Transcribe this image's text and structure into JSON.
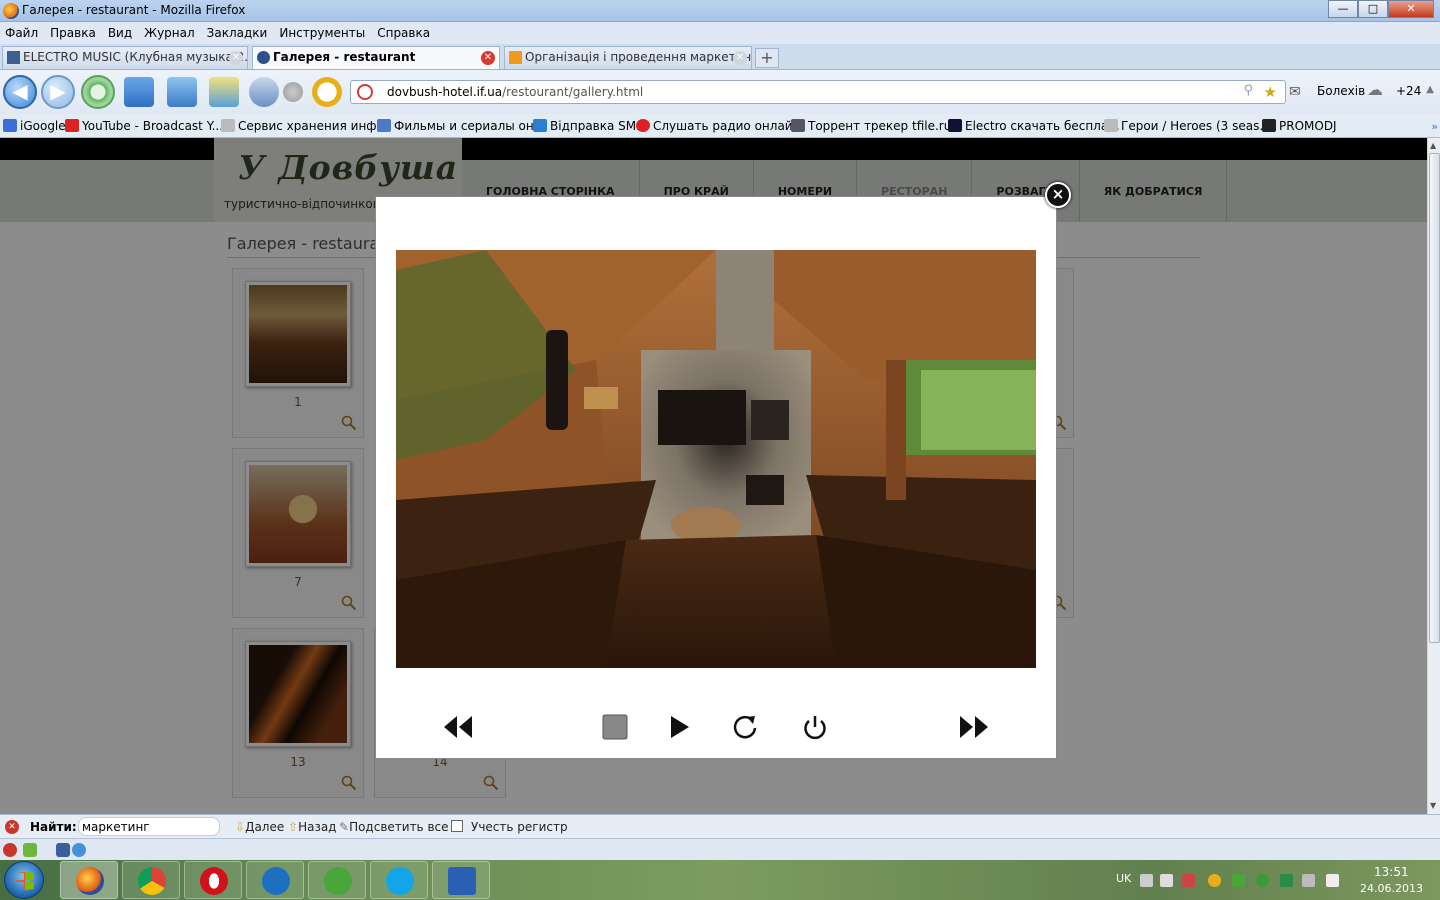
{
  "window": {
    "title": "Галерея - restaurant - Mozilla Firefox",
    "ghost_title": "—",
    "buttons": {
      "minimize": "—",
      "maximize": "□",
      "close": "✕"
    }
  },
  "menu": {
    "items": [
      "Файл",
      "Правка",
      "Вид",
      "Журнал",
      "Закладки",
      "Инструменты",
      "Справка"
    ]
  },
  "tabs": [
    {
      "label": "ELECTRO MUSIC (Клубная музыка 2...",
      "active": false
    },
    {
      "label": "Галерея - restaurant",
      "active": true
    },
    {
      "label": "Організація і проведення маркетин...",
      "active": false
    }
  ],
  "newtab_label": "+",
  "nav": {
    "url_host": "dovbush-hotel.if.ua",
    "url_path": "/restourant/gallery.html",
    "weather_city": "Болехів",
    "weather_temp": "+24"
  },
  "bookmarks": [
    {
      "label": "iGoogle",
      "icon": "igoogle-icon",
      "color": "#3a6fd8"
    },
    {
      "label": "YouTube - Broadcast Y...",
      "icon": "youtube-icon",
      "color": "#d22"
    },
    {
      "label": "Сервис хранения инф...",
      "icon": "ex-icon",
      "color": "#999"
    },
    {
      "label": "Фильмы и сериалы он...",
      "icon": "plane-icon",
      "color": "#4a7ac8"
    },
    {
      "label": "Відправка SMS",
      "icon": "star-icon",
      "color": "#2b7fd2"
    },
    {
      "label": "Слушать радио онлай...",
      "icon": "radio-icon",
      "color": "#d22"
    },
    {
      "label": "Торрент трекер tfile.ru...",
      "icon": "tfile-icon",
      "color": "#335"
    },
    {
      "label": "Electro скачать бесплa...",
      "icon": "electro-icon",
      "color": "#113"
    },
    {
      "label": "Герои / Heroes (3 seas...",
      "icon": "ex-icon",
      "color": "#999"
    },
    {
      "label": "PROMODJ",
      "icon": "promodj-icon",
      "color": "#222"
    }
  ],
  "site": {
    "logo_title": "У Довбуша",
    "logo_subtitle": "туристично-відпочинков",
    "nav": [
      "ГОЛОВНА СТОРІНКА",
      "ПРО КРАЙ",
      "НОМЕРИ",
      "РЕСТОРАН",
      "РОЗВАГИ",
      "ЯК ДОБРАТИСЯ"
    ],
    "current_nav": "РЕСТОРАН",
    "page_title": "Галерея - restaurant",
    "thumbs": [
      {
        "num": "1"
      },
      {
        "num": "7"
      },
      {
        "num": "13"
      },
      {
        "num": "14"
      }
    ]
  },
  "lightbox": {
    "close": "×",
    "photo_icon": "gallery-photo"
  },
  "findbar": {
    "label": "Найти:",
    "value": "маркетинг",
    "next": "Далее",
    "prev": "Назад",
    "highlight": "Подсветить все",
    "match_case": "Учесть регистр"
  },
  "taskbar": {
    "lang": "UK",
    "time": "13:51",
    "date": "24.06.2013",
    "apps": [
      "firefox",
      "chrome",
      "opera",
      "maxthon",
      "utorrent",
      "skype",
      "word"
    ]
  },
  "colors": {
    "accent_link": "#7a5a22",
    "overlay": "rgba(0,0,0,0.45)"
  }
}
